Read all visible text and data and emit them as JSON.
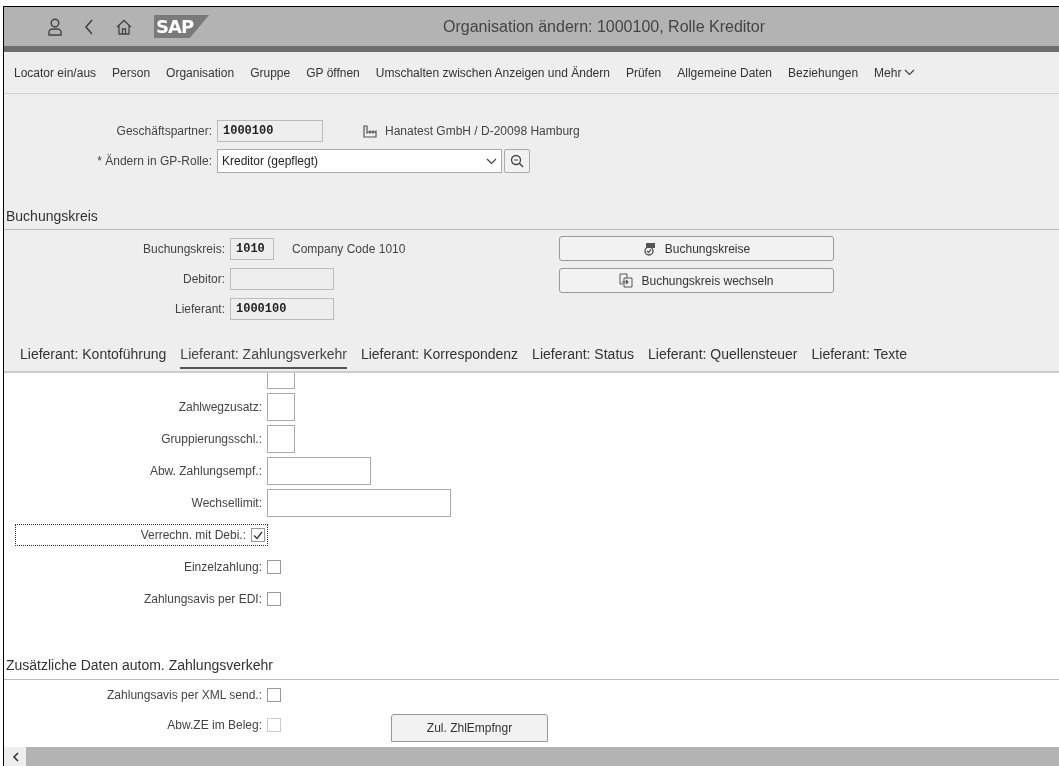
{
  "window": {
    "logo": "SAP",
    "title": "Organisation ändern: 1000100, Rolle Kreditor"
  },
  "menu": [
    {
      "label": "Locator ein/aus",
      "kind": "plain"
    },
    {
      "label": "Person",
      "kind": "plain"
    },
    {
      "label": "Organisation",
      "kind": "plain"
    },
    {
      "label": "Gruppe",
      "kind": "plain"
    },
    {
      "label": "GP öffnen",
      "kind": "plain"
    },
    {
      "label": "Umschalten zwischen Anzeigen und Ändern",
      "kind": "plain"
    },
    {
      "label": "Prüfen",
      "kind": "plain"
    },
    {
      "label": "Allgemeine Daten",
      "kind": "plain"
    },
    {
      "label": "Beziehungen",
      "kind": "plain"
    },
    {
      "label": "Mehr",
      "kind": "more"
    }
  ],
  "header": {
    "partner_label": "Geschäftspartner:",
    "partner_value": "1000100",
    "partner_name": "Hanatest GmbH / D-20098 Hamburg",
    "role_label": "* Ändern in GP-Rolle:",
    "role_value": "Kreditor (gepflegt)"
  },
  "company_section": {
    "title": "Buchungskreis",
    "fields": [
      {
        "label": "Buchungskreis:",
        "value": "1010",
        "description": "Company Code 1010"
      },
      {
        "label": "Debitor:"
      },
      {
        "label": "Lieferant:",
        "value": "1000100"
      }
    ],
    "buttons": [
      {
        "label": "Buchungskreise"
      },
      {
        "label": "Buchungskreis wechseln"
      }
    ]
  },
  "tabs": [
    {
      "label": "Lieferant: Kontoführung",
      "selected": false
    },
    {
      "label": "Lieferant: Zahlungsverkehr",
      "selected": true
    },
    {
      "label": "Lieferant: Korrespondenz",
      "selected": false
    },
    {
      "label": "Lieferant: Status",
      "selected": false
    },
    {
      "label": "Lieferant: Quellensteuer",
      "selected": false
    },
    {
      "label": "Lieferant: Texte",
      "selected": false
    }
  ],
  "payment_fields": [
    {
      "kind": "text"
    },
    {
      "kind": "text",
      "label": "Zahlwegzusatz:"
    },
    {
      "kind": "text",
      "label": "Gruppierungsschl.:"
    },
    {
      "kind": "text",
      "label": "Abw. Zahlungsempf.:"
    },
    {
      "kind": "text",
      "label": "Wechsellimit:"
    },
    {
      "kind": "checkbox",
      "label": "Verrechn. mit Debi.:",
      "checked": true,
      "focused": true
    },
    {
      "kind": "checkbox",
      "label": "Einzelzahlung:",
      "checked": false,
      "focused": false
    },
    {
      "kind": "checkbox",
      "label": "Zahlungsavis per EDI:",
      "checked": false,
      "focused": false
    }
  ],
  "auto_section": {
    "title": "Zusätzliche Daten autom. Zahlungsverkehr",
    "rows": [
      {
        "label": "Zahlungsavis per XML send.:",
        "checked": false,
        "disabled": false
      },
      {
        "label": "Abw.ZE im Beleg:",
        "checked": false,
        "disabled": true
      }
    ],
    "button": "Zul. ZhlEmpfngr"
  }
}
